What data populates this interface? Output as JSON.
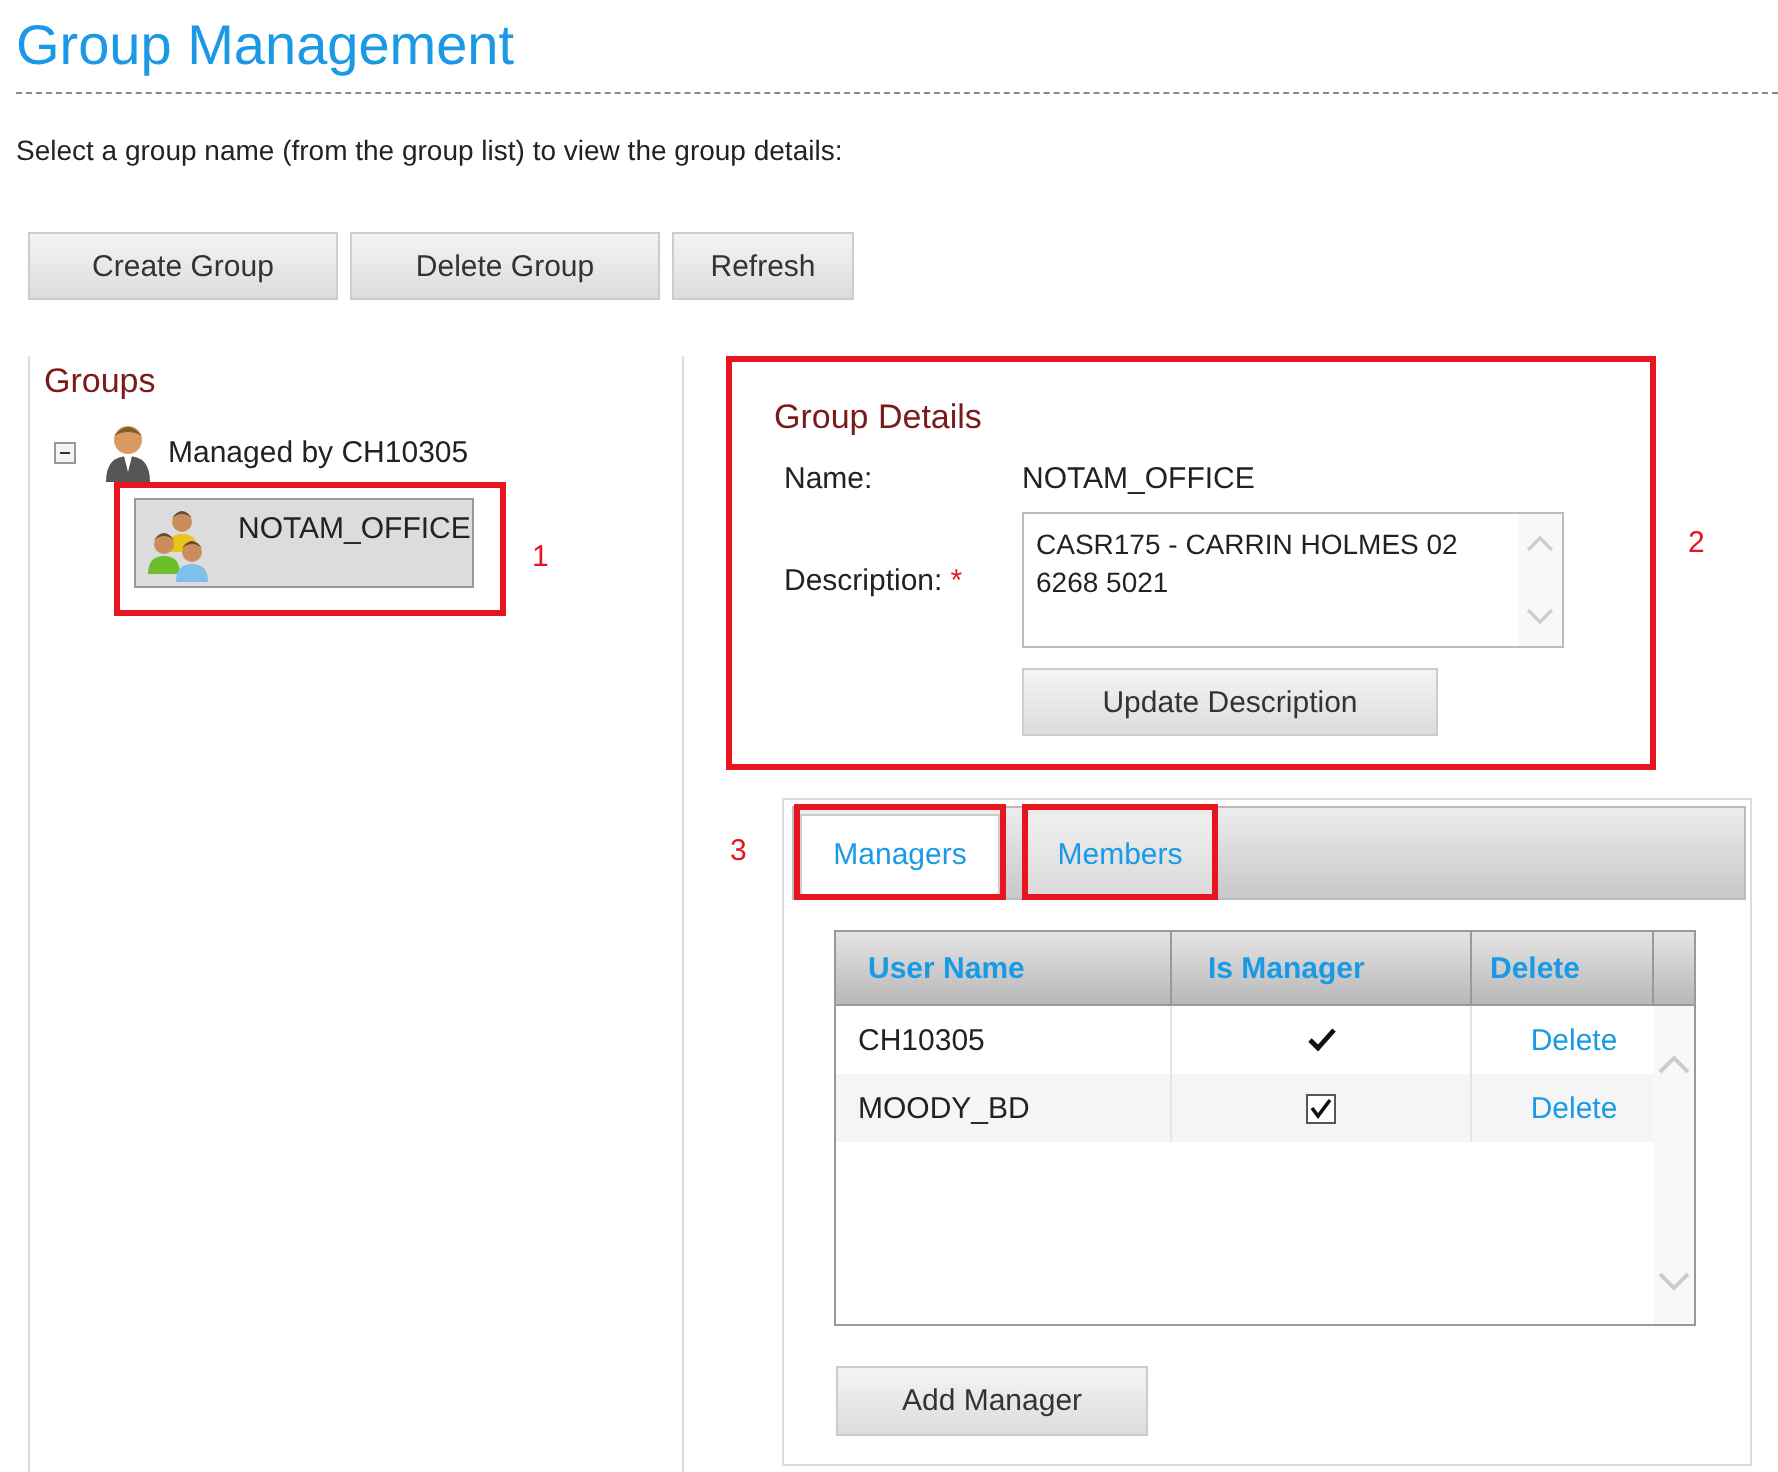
{
  "page": {
    "title": "Group Management",
    "instruction": "Select a group name (from the group list) to view the group details:"
  },
  "toolbar": [
    "Create Group",
    "Delete Group",
    "Refresh"
  ],
  "groups": {
    "title": "Groups",
    "tree": [
      {
        "label": "Managed by CH10305",
        "kind": "manager",
        "expanded": true,
        "selected": false,
        "children": [
          {
            "label": "NOTAM_OFFICE",
            "kind": "group",
            "selected": true,
            "callout": "1"
          }
        ]
      }
    ]
  },
  "group_details": {
    "title": "Group Details",
    "callout": "2",
    "fields": [
      {
        "label": "Name:",
        "kind": "text",
        "value": "NOTAM_OFFICE"
      },
      {
        "label": "Description:",
        "kind": "textarea",
        "required_mark": "*",
        "value": "CASR175 - CARRIN HOLMES 02 6268 5021"
      }
    ],
    "button": "Update Description"
  },
  "tabs_callout": "3",
  "tabs": [
    {
      "label": "Managers",
      "selected": true,
      "outlined": true
    },
    {
      "label": "Members",
      "selected": false,
      "outlined": true
    }
  ],
  "table": {
    "columns": [
      "User Name",
      "Is Manager",
      "Delete"
    ],
    "rows": [
      {
        "user": "CH10305",
        "is_manager": {
          "kind": "tick",
          "checked": true
        },
        "action": "Delete"
      },
      {
        "user": "MOODY_BD",
        "is_manager": {
          "kind": "checkbox",
          "checked": true
        },
        "action": "Delete"
      }
    ]
  },
  "add_button": "Add Manager"
}
